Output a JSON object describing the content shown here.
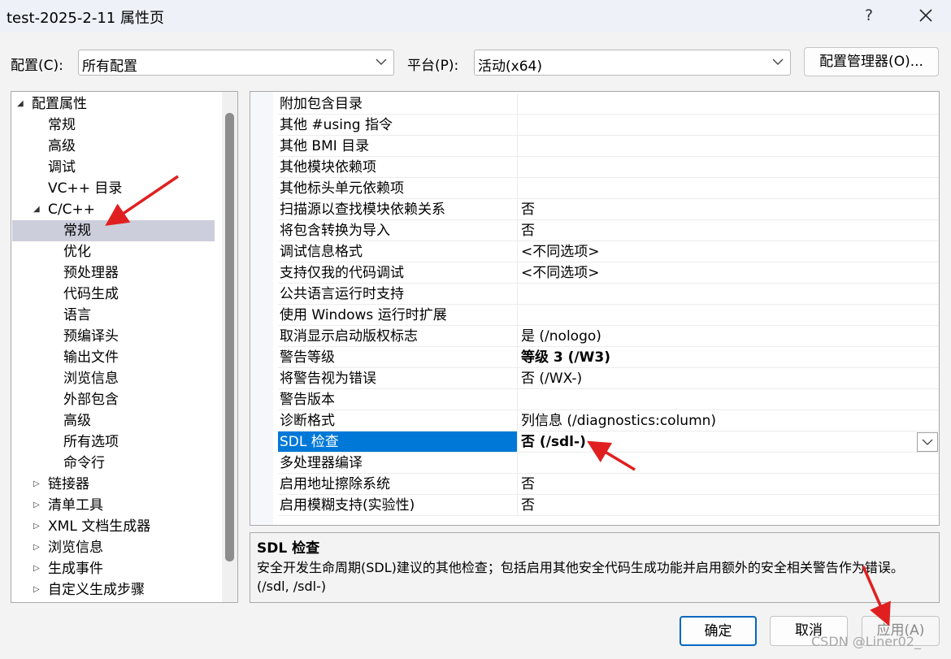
{
  "window": {
    "title": "test-2025-2-11 属性页",
    "help_label": "?"
  },
  "config": {
    "label": "配置(C):",
    "value": "所有配置",
    "platform_label": "平台(P):",
    "platform_value": "活动(x64)",
    "manager_button": "配置管理器(O)..."
  },
  "tree": {
    "root": "配置属性",
    "items": [
      "常规",
      "高级",
      "调试",
      "VC++ 目录"
    ],
    "cpp": "C/C++",
    "cpp_items": [
      "常规",
      "优化",
      "预处理器",
      "代码生成",
      "语言",
      "预编译头",
      "输出文件",
      "浏览信息",
      "外部包含",
      "高级",
      "所有选项",
      "命令行"
    ],
    "collapsed": [
      "链接器",
      "清单工具",
      "XML 文档生成器",
      "浏览信息",
      "生成事件",
      "自定义生成步骤"
    ]
  },
  "grid": {
    "rows": [
      {
        "name": "附加包含目录",
        "value": ""
      },
      {
        "name": "其他 #using 指令",
        "value": ""
      },
      {
        "name": "其他 BMI 目录",
        "value": ""
      },
      {
        "name": "其他模块依赖项",
        "value": ""
      },
      {
        "name": "其他标头单元依赖项",
        "value": ""
      },
      {
        "name": "扫描源以查找模块依赖关系",
        "value": "否"
      },
      {
        "name": "将包含转换为导入",
        "value": "否"
      },
      {
        "name": "调试信息格式",
        "value": "<不同选项>"
      },
      {
        "name": "支持仅我的代码调试",
        "value": "<不同选项>"
      },
      {
        "name": "公共语言运行时支持",
        "value": ""
      },
      {
        "name": "使用 Windows 运行时扩展",
        "value": ""
      },
      {
        "name": "取消显示启动版权标志",
        "value": "是 (/nologo)"
      },
      {
        "name": "警告等级",
        "value": "等级 3 (/W3)"
      },
      {
        "name": "将警告视为错误",
        "value": "否 (/WX-)"
      },
      {
        "name": "警告版本",
        "value": ""
      },
      {
        "name": "诊断格式",
        "value": "列信息 (/diagnostics:column)"
      },
      {
        "name": "SDL 检查",
        "value": "否 (/sdl-)"
      },
      {
        "name": "多处理器编译",
        "value": ""
      },
      {
        "name": "启用地址擦除系统",
        "value": "否"
      },
      {
        "name": "启用模糊支持(实验性)",
        "value": "否"
      }
    ]
  },
  "description": {
    "title": "SDL 检查",
    "text": "安全开发生命周期(SDL)建议的其他检查；包括启用其他安全代码生成功能并启用额外的安全相关警告作为错误。    (/sdl, /sdl-)"
  },
  "buttons": {
    "ok": "确定",
    "cancel": "取消",
    "apply": "应用(A)"
  },
  "watermark": "CSDN @Liner02_",
  "colors": {
    "selection": "#0078d7",
    "tree_selection": "#cccedb",
    "arrow": "#e02020"
  }
}
